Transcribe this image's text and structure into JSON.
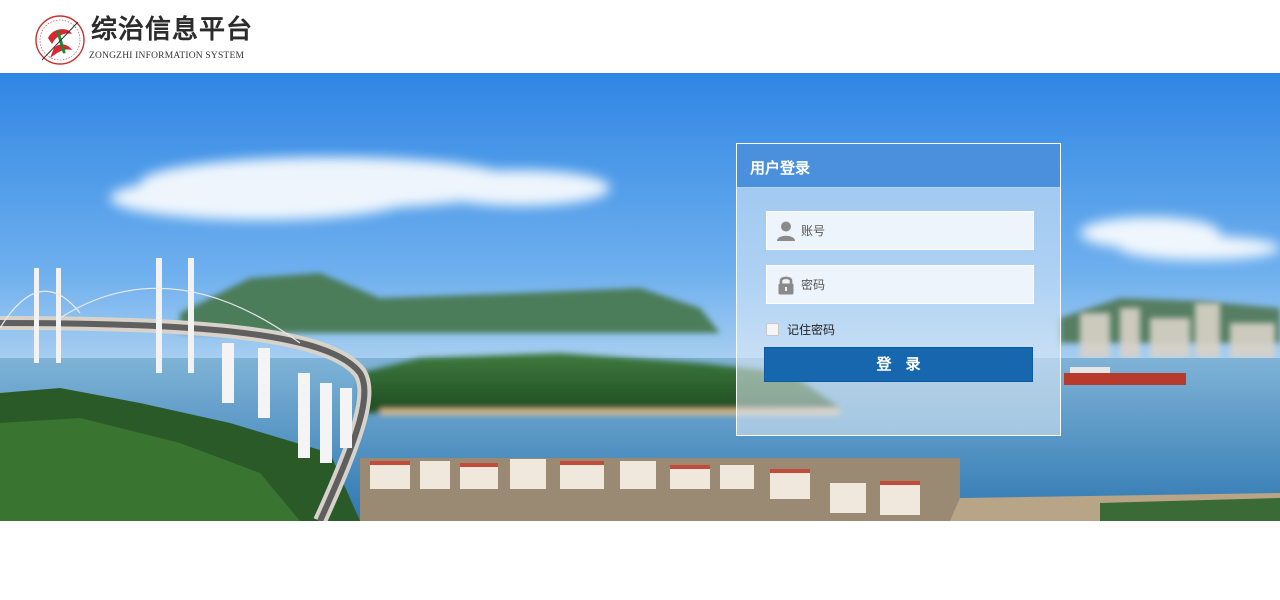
{
  "header": {
    "title": "综治信息平台",
    "subtitle": "ZONGZHI INFORMATION SYSTEM",
    "logo_icon": "emblem-logo-icon"
  },
  "login": {
    "title": "用户登录",
    "username_placeholder": "账号",
    "password_placeholder": "密码",
    "remember_label": "记住密码",
    "remember_checked": false,
    "submit_label": "登录",
    "user_icon": "user-icon",
    "lock_icon": "lock-icon"
  },
  "colors": {
    "panel_header": "#4a90dc",
    "button": "#1667ad",
    "sky": "#3a8fe6"
  }
}
